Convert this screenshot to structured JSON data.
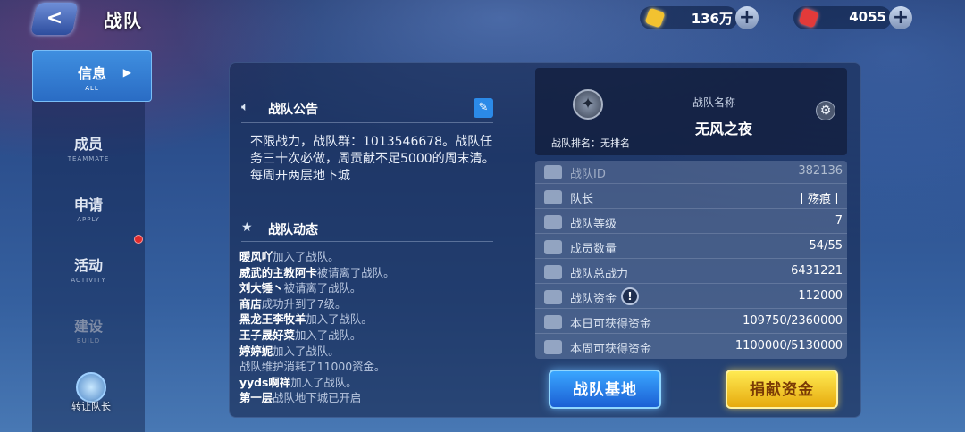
{
  "header": {
    "back_symbol": "<",
    "title": "战队",
    "gold_amount": "136万",
    "gem_amount": "4055",
    "plus_symbol": "+"
  },
  "sidebar": {
    "tabs": [
      {
        "cn": "信息",
        "en": "ALL"
      },
      {
        "cn": "成员",
        "en": "TEAMMATE"
      },
      {
        "cn": "申请",
        "en": "APPLY"
      },
      {
        "cn": "活动",
        "en": "ACTIVITY"
      },
      {
        "cn": "建设",
        "en": "BUILD"
      }
    ],
    "active_arrow": "▶",
    "transfer_label": "转让队长"
  },
  "announcement": {
    "heading": "战队公告",
    "text": "不限战力，战队群：1013546678。战队任务三十次必做，周贡献不足5000的周末清。每周开两层地下城"
  },
  "news": {
    "heading": "战队动态",
    "lines": [
      {
        "who": "暖风吖",
        "what": "加入了战队。"
      },
      {
        "who": "威武的主教阿卡",
        "what": "被请离了战队。"
      },
      {
        "who": "刘大锤丶",
        "what": "被请离了战队。"
      },
      {
        "who": "商店",
        "what": "成功升到了7级。"
      },
      {
        "who": "黑龙王李牧羊",
        "what": "加入了战队。"
      },
      {
        "who": "王子晟好菜",
        "what": "加入了战队。"
      },
      {
        "who": "婷婷妮",
        "what": "加入了战队。"
      },
      {
        "who": "",
        "what": "战队维护消耗了11000资金。"
      },
      {
        "who": "yyds啊祥",
        "what": "加入了战队。"
      },
      {
        "who": "第一层",
        "what": "战队地下城已开启"
      }
    ]
  },
  "team": {
    "rank_text": "战队排名：无排名",
    "name_label": "战队名称",
    "name": "无风之夜",
    "emblem_symbol": "✦",
    "settings_symbol": "⚙"
  },
  "stats": [
    {
      "label": "战队ID",
      "value": "382136"
    },
    {
      "label": "队长",
      "value": "丨殇痕丨"
    },
    {
      "label": "战队等级",
      "value": "7"
    },
    {
      "label": "成员数量",
      "value": "54/55"
    },
    {
      "label": "战队总战力",
      "value": "6431221"
    },
    {
      "label": "战队资金",
      "value": "112000"
    },
    {
      "label": "本日可获得资金",
      "value": "109750/2360000"
    },
    {
      "label": "本周可获得资金",
      "value": "1100000/5130000"
    }
  ],
  "buttons": {
    "base": "战队基地",
    "donate": "捐献资金"
  }
}
